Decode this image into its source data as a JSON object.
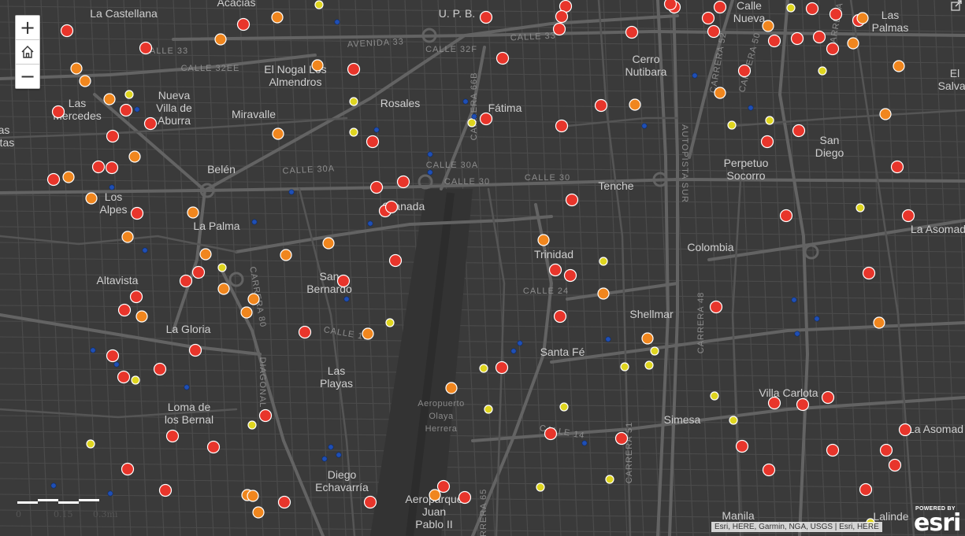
{
  "controls": {
    "zoom_in": "+",
    "home": "⌂",
    "zoom_out": "−",
    "expand": "⤢"
  },
  "scale": {
    "labels": [
      "0",
      "0.15",
      "0.3mi"
    ]
  },
  "attribution": "Esri, HERE, Garmin, NGA, USGS | Esri, HERE",
  "powered_by": "POWERED BY",
  "brand": "esri",
  "colors": {
    "red": "#e8352b",
    "orange": "#f0861e",
    "yellow": "#dfd51f",
    "blue": "#1f4fb5",
    "roads": "#585858",
    "background": "#3a3a3a"
  },
  "places": [
    {
      "lines": [
        "La Castellana"
      ]
    },
    {
      "lines": [
        "Acacias"
      ]
    },
    {
      "lines": [
        "U. P. B."
      ]
    },
    {
      "lines": [
        "Calle",
        "Nueva"
      ]
    },
    {
      "lines": [
        "Las",
        "Palmas"
      ]
    },
    {
      "lines": [
        "El Nogal Los",
        "Almendros"
      ]
    },
    {
      "lines": [
        "Cerro",
        "Nutibara"
      ]
    },
    {
      "lines": [
        "El",
        "Salvad"
      ]
    },
    {
      "lines": [
        "Las",
        "Mercedes"
      ]
    },
    {
      "lines": [
        "Nueva",
        "Villa de",
        "Aburra"
      ]
    },
    {
      "lines": [
        "Miravalle"
      ]
    },
    {
      "lines": [
        "Rosales"
      ]
    },
    {
      "lines": [
        "Fátima"
      ]
    },
    {
      "lines": [
        "as",
        "etas"
      ]
    },
    {
      "lines": [
        "San",
        "Diego"
      ]
    },
    {
      "lines": [
        "Perpetuo",
        "Socorro"
      ]
    },
    {
      "lines": [
        "Belén"
      ]
    },
    {
      "lines": [
        "Los",
        "Alpes"
      ]
    },
    {
      "lines": [
        "Tenche"
      ]
    },
    {
      "lines": [
        "Granada"
      ]
    },
    {
      "lines": [
        "La Palma"
      ]
    },
    {
      "lines": [
        "La Asomad"
      ]
    },
    {
      "lines": [
        "Colombia"
      ]
    },
    {
      "lines": [
        "Trinidad"
      ]
    },
    {
      "lines": [
        "Altavista"
      ]
    },
    {
      "lines": [
        "San",
        "Bernardo"
      ]
    },
    {
      "lines": [
        "Shellmar"
      ]
    },
    {
      "lines": [
        "La Gloria"
      ]
    },
    {
      "lines": [
        "Santa Fé"
      ]
    },
    {
      "lines": [
        "Las",
        "Playas"
      ]
    },
    {
      "lines": [
        "Villa Carlota"
      ]
    },
    {
      "lines": [
        "Loma de",
        "los Bernal"
      ]
    },
    {
      "lines": [
        "Simesa"
      ]
    },
    {
      "lines": [
        "La Asomad"
      ]
    },
    {
      "lines": [
        "Diego",
        "Echavarría"
      ]
    },
    {
      "lines": [
        "Aeroparque",
        "Juan",
        "Pablo II"
      ]
    },
    {
      "lines": [
        "Manila"
      ]
    },
    {
      "lines": [
        "Lalinde"
      ]
    }
  ],
  "streets": [
    {
      "text": "AVENIDA 33"
    },
    {
      "text": "CALLE 33"
    },
    {
      "text": "CALLE 32F"
    },
    {
      "text": "CALLE 33"
    },
    {
      "text": "CALLE 32EE"
    },
    {
      "text": "CALLE 30A"
    },
    {
      "text": "CALLE 30A"
    },
    {
      "text": "CALLE 30"
    },
    {
      "text": "CALLE 30"
    },
    {
      "text": "CARRERA 66B"
    },
    {
      "text": "CALLE 24"
    },
    {
      "text": "CALLE 19"
    },
    {
      "text": "CALLE 14"
    },
    {
      "text": "CARRERA 80"
    },
    {
      "text": "DIAGONAL"
    },
    {
      "text": "AUTOPISTA SUR"
    },
    {
      "text": "CARRERA 48"
    },
    {
      "text": "CARRERA 51"
    },
    {
      "text": "CARRERA 52"
    },
    {
      "text": "CARRERA 50"
    },
    {
      "text": "CARRERA 65"
    },
    {
      "text": "CARRERA 44"
    }
  ],
  "airport_label": [
    "Aeropuerto",
    "Olaya",
    "Herrera"
  ]
}
